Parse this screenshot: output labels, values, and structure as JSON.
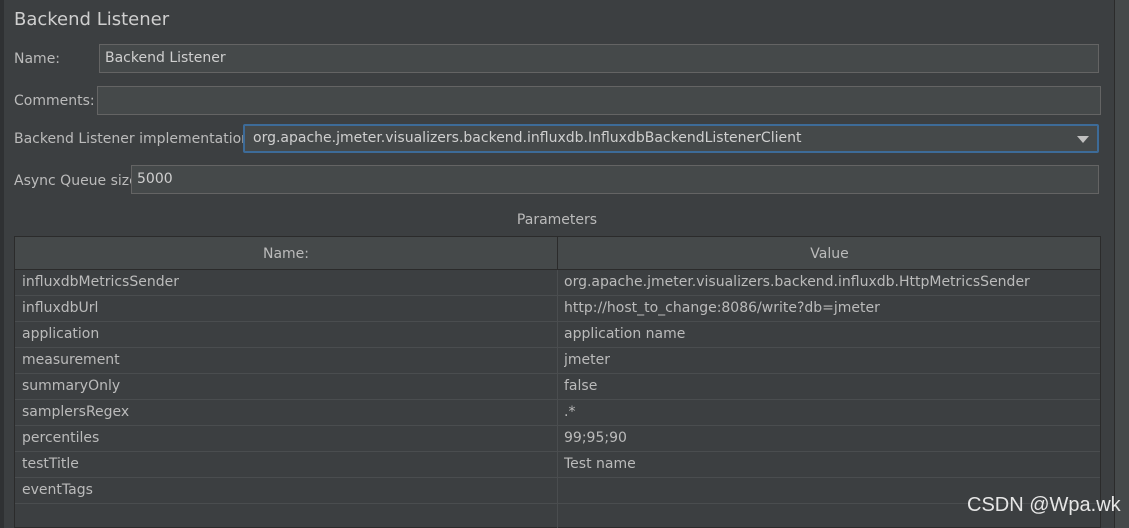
{
  "panel": {
    "title": "Backend Listener"
  },
  "form": {
    "name_label": "Name:",
    "name_value": "Backend Listener",
    "comments_label": "Comments:",
    "comments_value": "",
    "impl_label": "Backend Listener implementation",
    "impl_value": "org.apache.jmeter.visualizers.backend.influxdb.InfluxdbBackendListenerClient",
    "queue_label": "Async Queue size",
    "queue_value": "5000"
  },
  "parameters": {
    "title": "Parameters",
    "columns": [
      "Name:",
      "Value"
    ],
    "rows": [
      {
        "name": "influxdbMetricsSender",
        "value": "org.apache.jmeter.visualizers.backend.influxdb.HttpMetricsSender"
      },
      {
        "name": "influxdbUrl",
        "value": "http://host_to_change:8086/write?db=jmeter"
      },
      {
        "name": "application",
        "value": "application name"
      },
      {
        "name": "measurement",
        "value": "jmeter"
      },
      {
        "name": "summaryOnly",
        "value": "false"
      },
      {
        "name": "samplersRegex",
        "value": ".*"
      },
      {
        "name": "percentiles",
        "value": "99;95;90"
      },
      {
        "name": "testTitle",
        "value": "Test name"
      },
      {
        "name": "eventTags",
        "value": ""
      }
    ]
  },
  "watermark": "CSDN @Wpa.wk",
  "icons": {
    "dropdown": "chevron-down-icon"
  },
  "colors": {
    "background": "#3c3f41",
    "field": "#45494a",
    "focus_border": "#3d6b98"
  }
}
